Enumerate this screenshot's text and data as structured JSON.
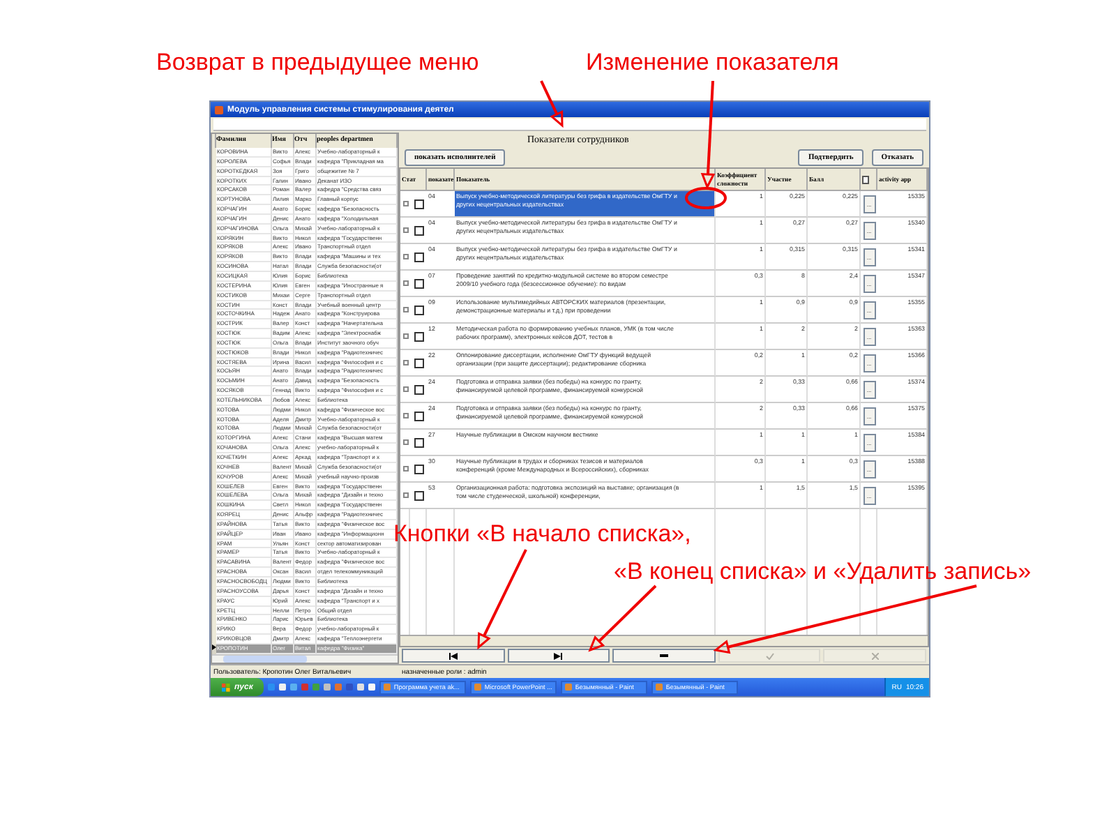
{
  "annotations": [
    {
      "text": "Возврат в предыдущее меню"
    },
    {
      "text": "Изменение показателя"
    },
    {
      "text": "Кнопки «В начало списка»,"
    },
    {
      "text": "«В конец списка» и «Удалить запись»"
    }
  ],
  "window": {
    "title": "Модуль управления системы стимулирования деятел"
  },
  "employees": {
    "columns": [
      "Фамилия",
      "Имя",
      "Отч",
      "peoples departmen"
    ],
    "rows": [
      {
        "surname": "КОРОВИНА",
        "name": "Викто",
        "patronymic": "Алекс",
        "department": "Учебно-лабораторный к",
        "selected": false
      },
      {
        "surname": "КОРОЛЕВА",
        "name": "Софья",
        "patronymic": "Влади",
        "department": "кафедра \"Прикладная ма",
        "selected": false
      },
      {
        "surname": "КОРОТКЕДКАЯ",
        "name": "Зоя",
        "patronymic": "Григо",
        "department": "общежитие № 7",
        "selected": false
      },
      {
        "surname": "КОРОТКИХ",
        "name": "Галин",
        "patronymic": "Ивано",
        "department": "Деканат ИЗО",
        "selected": false
      },
      {
        "surname": "КОРСАКОВ",
        "name": "Роман",
        "patronymic": "Валер",
        "department": "кафедра \"Средства связ",
        "selected": false
      },
      {
        "surname": "КОРТУНОВА",
        "name": "Лилия",
        "patronymic": "Марко",
        "department": "Главный корпус",
        "selected": false
      },
      {
        "surname": "КОРЧАГИН",
        "name": "Анато",
        "patronymic": "Борис",
        "department": "кафедра \"Безопасность",
        "selected": false
      },
      {
        "surname": "КОРЧАГИН",
        "name": "Денис",
        "patronymic": "Анато",
        "department": "кафедра \"Холодильная",
        "selected": false
      },
      {
        "surname": "КОРЧАГИНОВА",
        "name": "Ольга",
        "patronymic": "Михай",
        "department": "Учебно-лабораторный к",
        "selected": false
      },
      {
        "surname": "КОРЯКИН",
        "name": "Викто",
        "patronymic": "Никол",
        "department": "кафедра \"Государственн",
        "selected": false
      },
      {
        "surname": "КОРЯКОВ",
        "name": "Алекс",
        "patronymic": "Ивано",
        "department": "Транспортный отдел",
        "selected": false
      },
      {
        "surname": "КОРЯКОВ",
        "name": "Викто",
        "patronymic": "Влади",
        "department": "кафедра \"Машины и тех",
        "selected": false
      },
      {
        "surname": "КОСИНОВА",
        "name": "Натал",
        "patronymic": "Влади",
        "department": "Служба безопасности(от",
        "selected": false
      },
      {
        "surname": "КОСИЦКАЯ",
        "name": "Юлия",
        "patronymic": "Борис",
        "department": "Библиотека",
        "selected": false
      },
      {
        "surname": "КОСТЕРИНА",
        "name": "Юлия",
        "patronymic": "Евген",
        "department": "кафедра \"Иностранные я",
        "selected": false
      },
      {
        "surname": "КОСТИКОВ",
        "name": "Михаи",
        "patronymic": "Серге",
        "department": "Транспортный отдел",
        "selected": false
      },
      {
        "surname": "КОСТИН",
        "name": "Конст",
        "patronymic": "Влади",
        "department": "Учебный военный центр",
        "selected": false
      },
      {
        "surname": "КОСТОЧКИНА",
        "name": "Надеж",
        "patronymic": "Анато",
        "department": "кафедра \"Конструирова",
        "selected": false
      },
      {
        "surname": "КОСТРИК",
        "name": "Валер",
        "patronymic": "Конст",
        "department": "кафедра \"Начертательна",
        "selected": false
      },
      {
        "surname": "КОСТЮК",
        "name": "Вадим",
        "patronymic": "Алекс",
        "department": "кафедра \"Электроснабж",
        "selected": false
      },
      {
        "surname": "КОСТЮК",
        "name": "Ольга",
        "patronymic": "Влади",
        "department": "Институт заочного обуч",
        "selected": false
      },
      {
        "surname": "КОСТЮКОВ",
        "name": "Влади",
        "patronymic": "Никол",
        "department": "кафедра \"Радиотехничес",
        "selected": false
      },
      {
        "surname": "КОСТЯЕВА",
        "name": "Ирина",
        "patronymic": "Васил",
        "department": "кафедра \"Философия и с",
        "selected": false
      },
      {
        "surname": "КОСЬЯН",
        "name": "Анато",
        "patronymic": "Влади",
        "department": "кафедра \"Радиотехничес",
        "selected": false
      },
      {
        "surname": "КОСЬМИН",
        "name": "Анато",
        "patronymic": "Давид",
        "department": "кафедра \"Безопасность",
        "selected": false
      },
      {
        "surname": "КОСЯКОВ",
        "name": "Геннад",
        "patronymic": "Викто",
        "department": "кафедра \"Философия и с",
        "selected": false
      },
      {
        "surname": "КОТЕЛЬНИКОВА",
        "name": "Любов",
        "patronymic": "Алекс",
        "department": "Библиотека",
        "selected": false
      },
      {
        "surname": "КОТОВА",
        "name": "Людми",
        "patronymic": "Никол",
        "department": "кафедра \"Физическое вос",
        "selected": false
      },
      {
        "surname": "КОТОВА",
        "name": "Аделя",
        "patronymic": "Дмитр",
        "department": "Учебно-лабораторный к",
        "selected": false
      },
      {
        "surname": "КОТОВА",
        "name": "Людми",
        "patronymic": "Михай",
        "department": "Служба безопасности(от",
        "selected": false
      },
      {
        "surname": "КОТОРГИНА",
        "name": "Алекс",
        "patronymic": "Стани",
        "department": "кафедра \"Высшая матем",
        "selected": false
      },
      {
        "surname": "КОЧАНОВА",
        "name": "Ольга",
        "patronymic": "Алекс",
        "department": "учебно-лабораторный к",
        "selected": false
      },
      {
        "surname": "КОЧЕТКИН",
        "name": "Алекс",
        "patronymic": "Аркад",
        "department": "кафедра \"Транспорт и х",
        "selected": false
      },
      {
        "surname": "КОЧНЕВ",
        "name": "Валент",
        "patronymic": "Михай",
        "department": "Служба безопасности(от",
        "selected": false
      },
      {
        "surname": "КОЧУРОВ",
        "name": "Алекс",
        "patronymic": "Михай",
        "department": "учебный научно-произв",
        "selected": false
      },
      {
        "surname": "КОШЕЛЕВ",
        "name": "Евген",
        "patronymic": "Викто",
        "department": "кафедра \"Государственн",
        "selected": false
      },
      {
        "surname": "КОШЕЛЕВА",
        "name": "Ольга",
        "patronymic": "Михай",
        "department": "кафедра \"Дизайн и техно",
        "selected": false
      },
      {
        "surname": "КОШКИНА",
        "name": "Светл",
        "patronymic": "Никол",
        "department": "кафедра \"Государственн",
        "selected": false
      },
      {
        "surname": "КОЯРЕЦ",
        "name": "Денис",
        "patronymic": "Альфр",
        "department": "кафедра \"Радиотехничес",
        "selected": false
      },
      {
        "surname": "КРАЙНОВА",
        "name": "Татья",
        "patronymic": "Викто",
        "department": "кафедра \"Физическое вос",
        "selected": false
      },
      {
        "surname": "КРАЙЦЕР",
        "name": "Иван",
        "patronymic": "Ивано",
        "department": "кафедра \"Информационн",
        "selected": false
      },
      {
        "surname": "КРАМ",
        "name": "Ульян",
        "patronymic": "Конст",
        "department": "сектор автоматизирован",
        "selected": false
      },
      {
        "surname": "КРАМЕР",
        "name": "Татья",
        "patronymic": "Викто",
        "department": "Учебно-лабораторный к",
        "selected": false
      },
      {
        "surname": "КРАСАВИНА",
        "name": "Валент",
        "patronymic": "Федор",
        "department": "кафедра \"Физическое вос",
        "selected": false
      },
      {
        "surname": "КРАСНОВА",
        "name": "Оксан",
        "patronymic": "Васил",
        "department": "отдел телекоммуникаций",
        "selected": false
      },
      {
        "surname": "КРАСНОСВОБОДЦ",
        "name": "Людми",
        "patronymic": "Викто",
        "department": "Библиотека",
        "selected": false
      },
      {
        "surname": "КРАСНОУСОВА",
        "name": "Дарья",
        "patronymic": "Конст",
        "department": "кафедра \"Дизайн и техно",
        "selected": false
      },
      {
        "surname": "КРАУС",
        "name": "Юрий",
        "patronymic": "Алекс",
        "department": "кафедра \"Транспорт и х",
        "selected": false
      },
      {
        "surname": "КРЕТЦ",
        "name": "Нелли",
        "patronymic": "Петро",
        "department": "Общий отдел",
        "selected": false
      },
      {
        "surname": "КРИВЕНКО",
        "name": "Ларис",
        "patronymic": "Юрьев",
        "department": "Библиотека",
        "selected": false
      },
      {
        "surname": "КРИКО",
        "name": "Вера",
        "patronymic": "Федор",
        "department": "учебно-лабораторный к",
        "selected": false
      },
      {
        "surname": "КРИКОВЦОВ",
        "name": "Дмитр",
        "patronymic": "Алекс",
        "department": "кафедра \"Теплоэнергети",
        "selected": false
      },
      {
        "surname": "КРОПОТИН",
        "name": "Олег",
        "patronymic": "Витал",
        "department": "кафедра \"Физика\"",
        "selected": true
      }
    ]
  },
  "panel": {
    "title": "Показатели сотрудников",
    "buttons": [
      {
        "label": "показать исполнителей"
      },
      {
        "label": "Подтвердить"
      },
      {
        "label": "Отказать"
      }
    ]
  },
  "table": {
    "columns": [
      "Стат",
      "показате",
      "Показатель",
      "Коэффициент сложности",
      "Участие",
      "Балл",
      "activity app"
    ],
    "rows": [
      {
        "code": "04",
        "text": "Выпуск учебно-методической литературы без грифа в издательстве ОмГТУ и других нецентральных издательствах",
        "coef": "1",
        "part": "0,225",
        "score": "0,225",
        "action": "...",
        "id": "15335",
        "checked": false,
        "selected": true
      },
      {
        "code": "04",
        "text": "Выпуск учебно-методической литературы без грифа в издательстве ОмГТУ и других нецентральных издательствах",
        "coef": "1",
        "part": "0,27",
        "score": "0,27",
        "action": "...",
        "id": "15340",
        "checked": false,
        "selected": false
      },
      {
        "code": "04",
        "text": "Выпуск учебно-методической литературы без грифа в издательстве ОмГТУ и других нецентральных издательствах",
        "coef": "1",
        "part": "0,315",
        "score": "0,315",
        "action": "...",
        "id": "15341",
        "checked": false,
        "selected": false
      },
      {
        "code": "07",
        "text": "Проведение занятий по кредитно-модульной системе во втором семестре 2009/10 учебного года (безсессионное обучение): по видам",
        "coef": "0,3",
        "part": "8",
        "score": "2,4",
        "action": "...",
        "id": "15347",
        "checked": false,
        "selected": false
      },
      {
        "code": "09",
        "text": "Использование мультимедийных АВТОРСКИХ материалов (презентации, демонстрационные материалы и т.д.) при проведении",
        "coef": "1",
        "part": "0,9",
        "score": "0,9",
        "action": "...",
        "id": "15355",
        "checked": false,
        "selected": false
      },
      {
        "code": "12",
        "text": "Методическая работа по формированию учебных планов, УМК (в том числе рабочих программ), электронных кейсов ДОТ, тестов в",
        "coef": "1",
        "part": "2",
        "score": "2",
        "action": "...",
        "id": "15363",
        "checked": false,
        "selected": false
      },
      {
        "code": "22",
        "text": "Оппонирование диссертации, исполнение ОмГТУ функций ведущей организации (при защите диссертации); редактирование сборника",
        "coef": "0,2",
        "part": "1",
        "score": "0,2",
        "action": "...",
        "id": "15366",
        "checked": false,
        "selected": false
      },
      {
        "code": "24",
        "text": "Подготовка и отправка заявки (без победы) на конкурс по гранту, финансируемой целевой программе, финансируемой конкурсной",
        "coef": "2",
        "part": "0,33",
        "score": "0,66",
        "action": "...",
        "id": "15374",
        "checked": false,
        "selected": false
      },
      {
        "code": "24",
        "text": "Подготовка и отправка заявки (без победы) на конкурс по гранту, финансируемой целевой программе, финансируемой конкурсной",
        "coef": "2",
        "part": "0,33",
        "score": "0,66",
        "action": "...",
        "id": "15375",
        "checked": false,
        "selected": false
      },
      {
        "code": "27",
        "text": "Научные публикации в Омском научном вестнике",
        "coef": "1",
        "part": "1",
        "score": "1",
        "action": "...",
        "id": "15384",
        "checked": false,
        "selected": false
      },
      {
        "code": "30",
        "text": "Научные публикации в трудах и сборниках тезисов и материалов конференций (кроме Международных и Всероссийских), сборниках",
        "coef": "0,3",
        "part": "1",
        "score": "0,3",
        "action": "...",
        "id": "15388",
        "checked": false,
        "selected": false
      },
      {
        "code": "53",
        "text": "Организационная работа: подготовка экспозиций на выставке; организация (в том числе студенческой, школьной) конференции,",
        "coef": "1",
        "part": "1,5",
        "score": "1,5",
        "action": "...",
        "id": "15395",
        "checked": false,
        "selected": false
      }
    ]
  },
  "nav_buttons": [
    {
      "kind": "first",
      "disabled": false
    },
    {
      "kind": "last",
      "disabled": false
    },
    {
      "kind": "delete",
      "disabled": false
    },
    {
      "kind": "confirm",
      "disabled": true
    },
    {
      "kind": "cancel",
      "disabled": true
    }
  ],
  "status_bar": {
    "user": "Пользователь: Кропотин Олег Витальевич",
    "roles": "назначенные роли : admin"
  },
  "taskbar": {
    "start": "пуск",
    "tasks": [
      {
        "label": "Программа учета ak..."
      },
      {
        "label": "Microsoft PowerPoint ..."
      },
      {
        "label": "Безымянный - Paint"
      },
      {
        "label": "Безымянный - Paint"
      }
    ],
    "lang": "RU",
    "time": "10:26"
  }
}
